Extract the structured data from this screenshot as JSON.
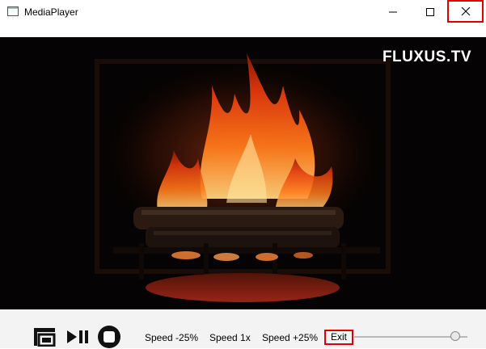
{
  "window": {
    "title": "MediaPlayer",
    "icon": "app-window-icon",
    "buttons": {
      "minimize": "minimize-icon",
      "maximize": "maximize-icon",
      "close": "close-icon"
    }
  },
  "video": {
    "watermark": "FLUXUS.TV",
    "content": "fireplace-video"
  },
  "controls": {
    "fullscreen_icon": "fullscreen-icon",
    "play_pause_icon": "play-pause-icon",
    "stop_icon": "stop-icon",
    "speed_down_label": "Speed -25%",
    "speed_normal_label": "Speed 1x",
    "speed_up_label": "Speed +25%",
    "exit_label": "Exit",
    "volume_level": 0.93
  },
  "colors": {
    "highlight": "#e00000",
    "video_bg": "#000000"
  }
}
